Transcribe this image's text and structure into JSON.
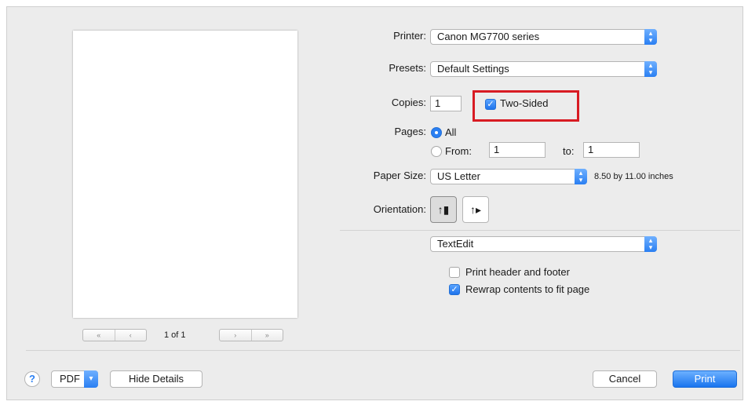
{
  "printer": {
    "label": "Printer:",
    "value": "Canon MG7700 series"
  },
  "presets": {
    "label": "Presets:",
    "value": "Default Settings"
  },
  "copies": {
    "label": "Copies:",
    "value": "1",
    "two_sided_label": "Two-Sided",
    "two_sided_checked": true
  },
  "pages": {
    "label": "Pages:",
    "all_label": "All",
    "from_label": "From:",
    "from_value": "1",
    "to_label": "to:",
    "to_value": "1",
    "selected": "All"
  },
  "paper_size": {
    "label": "Paper Size:",
    "value": "US Letter",
    "dimensions": "8.50 by 11.00 inches"
  },
  "orientation": {
    "label": "Orientation:",
    "selected": "portrait"
  },
  "section_popup": {
    "value": "TextEdit"
  },
  "options": [
    {
      "label": "Print header and footer",
      "checked": false
    },
    {
      "label": "Rewrap contents to fit page",
      "checked": true
    }
  ],
  "preview": {
    "page_indicator": "1 of 1"
  },
  "footer": {
    "help": "?",
    "pdf_label": "PDF",
    "hide_details_label": "Hide Details",
    "cancel_label": "Cancel",
    "print_label": "Print"
  },
  "colors": {
    "accent": "#2a7ff2",
    "highlight": "#d81b23",
    "dialog_bg": "#ececec"
  }
}
